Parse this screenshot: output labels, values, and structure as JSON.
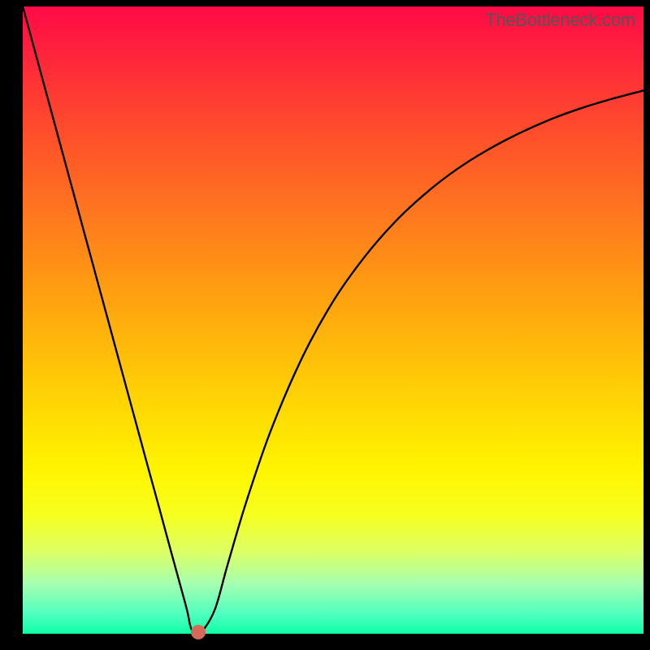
{
  "watermark": "TheBottleneck.com",
  "colors": {
    "frame": "#000000",
    "curve": "#000000",
    "dot": "#d66a5a"
  },
  "chart_data": {
    "type": "line",
    "title": "",
    "xlabel": "",
    "ylabel": "",
    "xlim": [
      0,
      100
    ],
    "ylim": [
      0,
      100
    ],
    "grid": false,
    "legend": false,
    "series": [
      {
        "name": "curve",
        "x": [
          0.0,
          2.5,
          5.0,
          7.5,
          10.0,
          12.5,
          15.0,
          17.5,
          20.0,
          22.0,
          24.0,
          25.5,
          26.5,
          27.0,
          27.5,
          28.0,
          29.0,
          31.0,
          33.0,
          36.0,
          40.0,
          45.0,
          50.0,
          55.0,
          60.0,
          65.0,
          70.0,
          75.0,
          80.0,
          85.0,
          90.0,
          95.0,
          100.0
        ],
        "y": [
          100.0,
          90.9,
          81.8,
          72.7,
          63.6,
          54.5,
          45.4,
          36.3,
          27.2,
          20.0,
          12.7,
          7.3,
          3.6,
          1.2,
          0.2,
          0.2,
          0.5,
          4.0,
          11.0,
          21.0,
          32.5,
          44.0,
          53.0,
          60.0,
          65.7,
          70.3,
          74.1,
          77.2,
          79.8,
          82.0,
          83.8,
          85.3,
          86.6
        ]
      }
    ],
    "marker": {
      "x": 28.3,
      "y": 0.2
    }
  }
}
